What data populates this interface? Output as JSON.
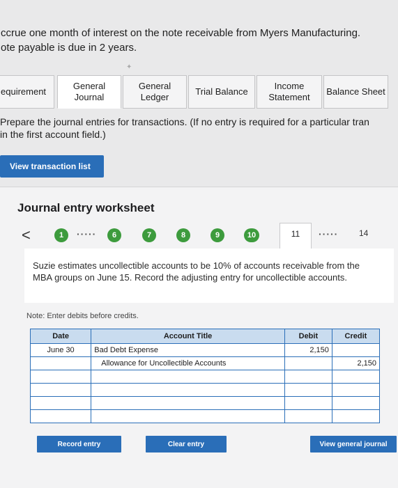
{
  "question": {
    "line1": "ccrue one month of interest on the note receivable from Myers Manufacturing.",
    "line2": "ote payable is due in 2 years."
  },
  "tabs": [
    {
      "label": "equirement",
      "active": false
    },
    {
      "label": "General Journal",
      "active": true
    },
    {
      "label": "General Ledger",
      "active": false
    },
    {
      "label": "Trial Balance",
      "active": false
    },
    {
      "label": "Income Statement",
      "active": false
    },
    {
      "label": "Balance Sheet",
      "active": false
    }
  ],
  "instructions": {
    "line1": "Prepare the journal entries for transactions. (If no entry is required for a particular tran",
    "line2": "in the first account field.)"
  },
  "view_transaction_list_label": "View transaction list",
  "worksheet": {
    "title": "Journal entry worksheet",
    "steps": [
      "1",
      "6",
      "7",
      "8",
      "9",
      "10",
      "11",
      "14"
    ],
    "current_step": "11",
    "description": "Suzie estimates uncollectible accounts to be 10% of accounts receivable from the MBA groups on June 15. Record the adjusting entry for uncollectible accounts.",
    "note": "Note: Enter debits before credits.",
    "columns": {
      "date": "Date",
      "account": "Account Title",
      "debit": "Debit",
      "credit": "Credit"
    },
    "rows": [
      {
        "date": "June 30",
        "account": "Bad Debt Expense",
        "debit": "2,150",
        "credit": ""
      },
      {
        "date": "",
        "account": "Allowance for Uncollectible Accounts",
        "debit": "",
        "credit": "2,150"
      },
      {
        "date": "",
        "account": "",
        "debit": "",
        "credit": ""
      },
      {
        "date": "",
        "account": "",
        "debit": "",
        "credit": ""
      },
      {
        "date": "",
        "account": "",
        "debit": "",
        "credit": ""
      },
      {
        "date": "",
        "account": "",
        "debit": "",
        "credit": ""
      }
    ]
  },
  "buttons": {
    "record": "Record entry",
    "clear": "Clear entry",
    "view_general_journal": "View general journal"
  },
  "colors": {
    "accent": "#2a6eb8",
    "step_done": "#3d9b3d",
    "header_bg": "#c9dcef"
  }
}
